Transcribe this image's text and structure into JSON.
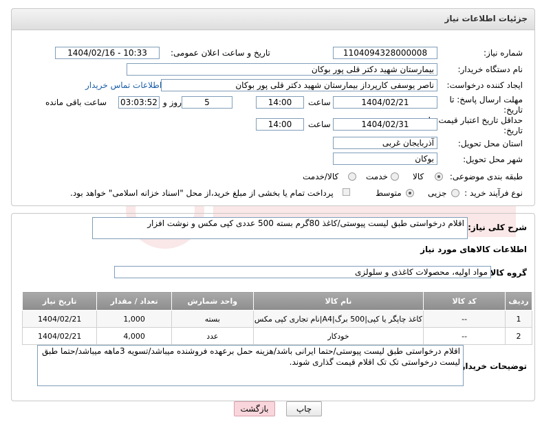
{
  "header": {
    "title": "جزئیات اطلاعات نیاز"
  },
  "fields": {
    "need_number_label": "شماره نیاز:",
    "need_number": "1104094328000008",
    "announce_label": "تاریخ و ساعت اعلان عمومی:",
    "announce_value": "1404/02/16 - 10:33",
    "buyer_org_label": "نام دستگاه خریدار:",
    "buyer_org": "بیمارستان شهید دکتر قلی پور بوکان",
    "creator_label": "ایجاد کننده درخواست:",
    "creator": "ناصر یوسفی کارپرداز بیمارستان شهید دکتر قلی پور بوکان",
    "contact_link": "اطلاعات تماس خریدار",
    "deadline_label": "مهلت ارسال پاسخ: تا تاریخ:",
    "deadline_date": "1404/02/21",
    "time_label": "ساعت",
    "deadline_time": "14:00",
    "days_value": "5",
    "days_label": "روز و",
    "remaining_time": "03:03:52",
    "remaining_label": "ساعت باقی مانده",
    "validity_label": "حداقل تاریخ اعتبار قیمت: تا تاریخ:",
    "validity_date": "1404/02/31",
    "validity_time": "14:00",
    "province_label": "استان محل تحویل:",
    "province": "آذربایجان غربی",
    "city_label": "شهر محل تحویل:",
    "city": "بوکان",
    "category_label": "طبقه بندی موضوعی:",
    "category_options": [
      "کالا",
      "خدمت",
      "کالا/خدمت"
    ],
    "purchase_type_label": "نوع فرآیند خرید :",
    "purchase_options": [
      "جزیی",
      "متوسط"
    ],
    "payment_note": "پرداخت تمام یا بخشی از مبلغ خرید،از محل \"اسناد خزانه اسلامی\" خواهد بود."
  },
  "description": {
    "label": "شرح کلی نیاز:",
    "text": "اقلام درخواستی طبق لیست پیوستی/کاغذ 80گرم بسته 500 عددی کپی مکس و نوشت افزار"
  },
  "goods": {
    "section_title": "اطلاعات کالاهای مورد نیاز",
    "group_label": "گروه کالا:",
    "group_value": "مواد اولیه، محصولات کاغذی و سلولزی",
    "columns": [
      "ردیف",
      "کد کالا",
      "نام کالا",
      "واحد شمارش",
      "تعداد / مقدار",
      "تاریخ نیاز"
    ],
    "rows": [
      [
        "1",
        "--",
        "کاغذ چاپگر یا کپی|500 برگ|A4|نام تجاری کپی مکس",
        "بسته",
        "1,000",
        "1404/02/21"
      ],
      [
        "2",
        "--",
        "خودکار",
        "عدد",
        "4,000",
        "1404/02/21"
      ]
    ]
  },
  "buyer_notes": {
    "label": "توضیحات خریدار:",
    "text": "اقلام درخواستی طبق لیست پیوستی/حتما ایرانی باشد/هزینه حمل برعهده فروشنده میباشد/تسویه 3ماهه میباشد/حتما طبق لیست درخواستی تک تک اقلام قیمت گذاری شوند."
  },
  "buttons": {
    "print": "چاپ",
    "back": "بازگشت"
  },
  "colors": {
    "link": "#1a5ea8",
    "header_bg": "#e6e6e6",
    "table_header": "#999999",
    "back_button": "#f9d6dc"
  }
}
